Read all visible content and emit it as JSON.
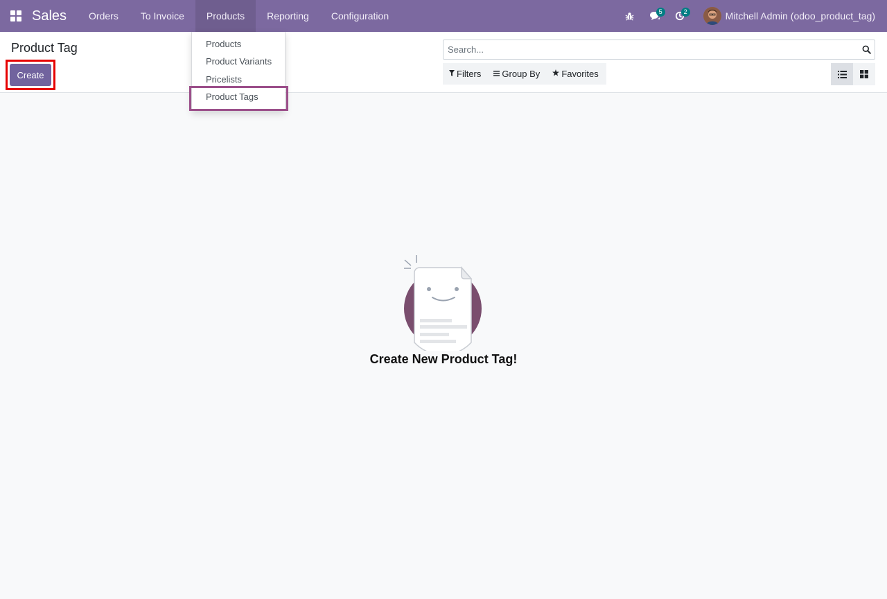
{
  "navbar": {
    "app_name": "Sales",
    "menu": [
      "Orders",
      "To Invoice",
      "Products",
      "Reporting",
      "Configuration"
    ],
    "active_menu": "Products",
    "messages_count": "5",
    "activities_count": "2",
    "user_label": "Mitchell Admin (odoo_product_tag)",
    "icons": [
      "apps-grid-icon",
      "bug-icon",
      "chat-icon",
      "clock-icon",
      "avatar"
    ]
  },
  "control_panel": {
    "title": "Product Tag",
    "create_label": "Create",
    "search_placeholder": "Search...",
    "filters_label": "Filters",
    "group_by_label": "Group By",
    "favorites_label": "Favorites"
  },
  "dropdown": {
    "items": [
      "Products",
      "Product Variants",
      "Pricelists",
      "Product Tags"
    ],
    "highlighted": "Product Tags"
  },
  "empty_state": {
    "title": "Create New Product Tag!"
  },
  "colors": {
    "navbar": "#7c69a0",
    "primary_button": "#71639e",
    "create_highlight": "#e60000",
    "menu_highlight": "#9b4f8a",
    "badge": "#017e84"
  }
}
